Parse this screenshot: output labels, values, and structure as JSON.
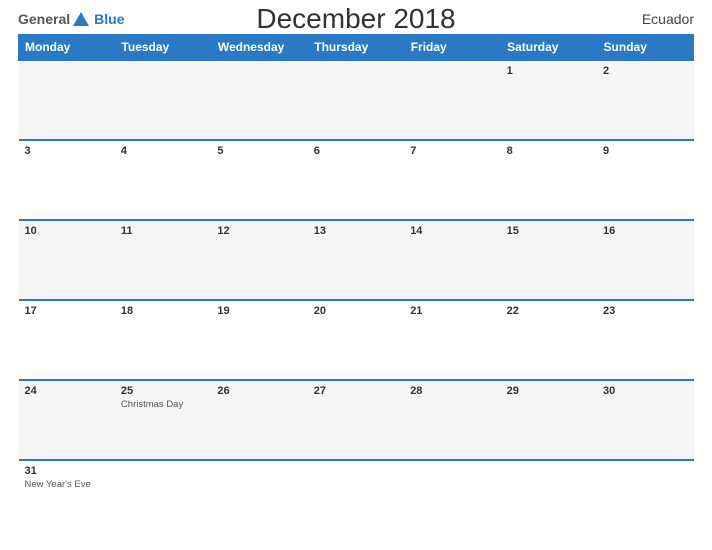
{
  "header": {
    "logo_general": "General",
    "logo_blue": "Blue",
    "title": "December 2018",
    "country": "Ecuador"
  },
  "weekdays": [
    "Monday",
    "Tuesday",
    "Wednesday",
    "Thursday",
    "Friday",
    "Saturday",
    "Sunday"
  ],
  "weeks": [
    [
      {
        "day": "",
        "holiday": ""
      },
      {
        "day": "",
        "holiday": ""
      },
      {
        "day": "",
        "holiday": ""
      },
      {
        "day": "",
        "holiday": ""
      },
      {
        "day": "",
        "holiday": ""
      },
      {
        "day": "1",
        "holiday": ""
      },
      {
        "day": "2",
        "holiday": ""
      }
    ],
    [
      {
        "day": "3",
        "holiday": ""
      },
      {
        "day": "4",
        "holiday": ""
      },
      {
        "day": "5",
        "holiday": ""
      },
      {
        "day": "6",
        "holiday": ""
      },
      {
        "day": "7",
        "holiday": ""
      },
      {
        "day": "8",
        "holiday": ""
      },
      {
        "day": "9",
        "holiday": ""
      }
    ],
    [
      {
        "day": "10",
        "holiday": ""
      },
      {
        "day": "11",
        "holiday": ""
      },
      {
        "day": "12",
        "holiday": ""
      },
      {
        "day": "13",
        "holiday": ""
      },
      {
        "day": "14",
        "holiday": ""
      },
      {
        "day": "15",
        "holiday": ""
      },
      {
        "day": "16",
        "holiday": ""
      }
    ],
    [
      {
        "day": "17",
        "holiday": ""
      },
      {
        "day": "18",
        "holiday": ""
      },
      {
        "day": "19",
        "holiday": ""
      },
      {
        "day": "20",
        "holiday": ""
      },
      {
        "day": "21",
        "holiday": ""
      },
      {
        "day": "22",
        "holiday": ""
      },
      {
        "day": "23",
        "holiday": ""
      }
    ],
    [
      {
        "day": "24",
        "holiday": ""
      },
      {
        "day": "25",
        "holiday": "Christmas Day"
      },
      {
        "day": "26",
        "holiday": ""
      },
      {
        "day": "27",
        "holiday": ""
      },
      {
        "day": "28",
        "holiday": ""
      },
      {
        "day": "29",
        "holiday": ""
      },
      {
        "day": "30",
        "holiday": ""
      }
    ],
    [
      {
        "day": "31",
        "holiday": "New Year's Eve"
      },
      {
        "day": "",
        "holiday": ""
      },
      {
        "day": "",
        "holiday": ""
      },
      {
        "day": "",
        "holiday": ""
      },
      {
        "day": "",
        "holiday": ""
      },
      {
        "day": "",
        "holiday": ""
      },
      {
        "day": "",
        "holiday": ""
      }
    ]
  ]
}
